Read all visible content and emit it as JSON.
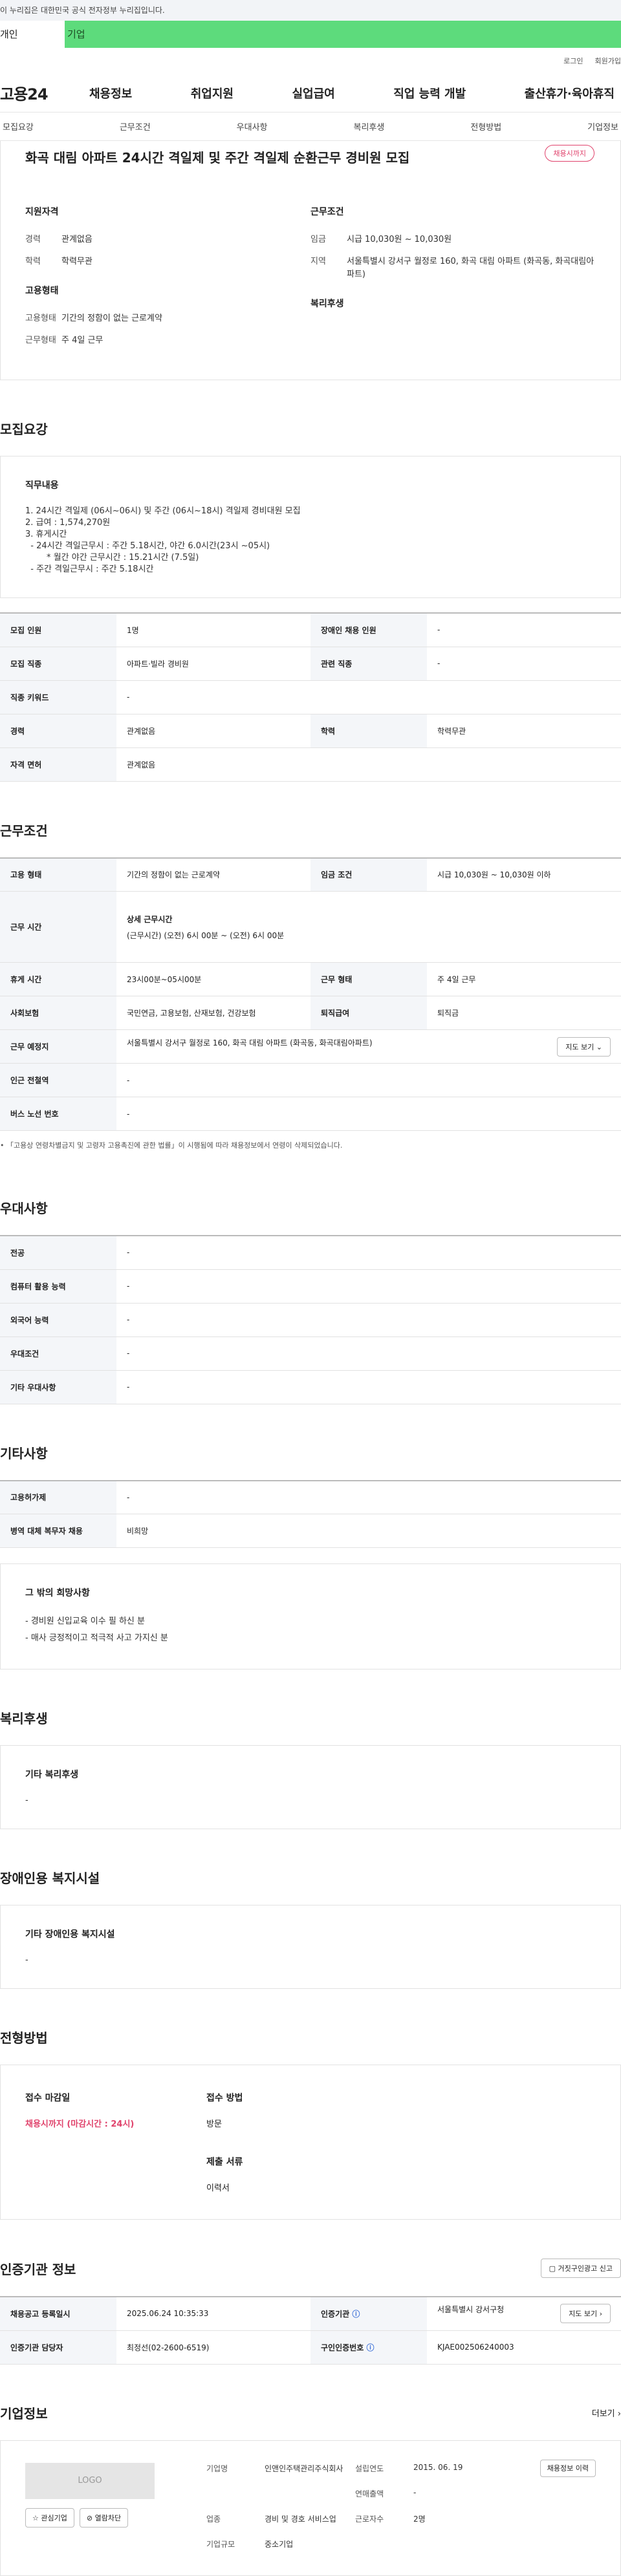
{
  "gov_bar": "이 누리집은 대한민국 공식 전자정부 누리집입니다.",
  "user_tabs": {
    "personal": "개인",
    "corp": "기업"
  },
  "util": {
    "login": "로그인",
    "join": "회원가입"
  },
  "logo": "고용24",
  "gnb": [
    "채용정보",
    "취업지원",
    "실업급여",
    "직업 능력 개발",
    "출산휴가·육아휴직"
  ],
  "subtabs": [
    "모집요강",
    "근무조건",
    "우대사항",
    "복리후생",
    "전형방법",
    "기업정보"
  ],
  "summary": {
    "title": "화곡 대림 아파트 24시간 격일제 및 주간 격일제 순환근무 경비원 모집",
    "badge": "채용시까지",
    "qual_title": "지원자격",
    "career_k": "경력",
    "career_v": "관계없음",
    "edu_k": "학력",
    "edu_v": "학력무관",
    "cond_title": "근무조건",
    "wage_k": "임금",
    "wage_v": "시급 10,030원 ~ 10,030원",
    "area_k": "지역",
    "area_v": "서울특별시 강서구 월정로 160, 화곡 대림 아파트 (화곡동, 화곡대림아파트)",
    "emp_title": "고용형태",
    "emp_k": "고용형태",
    "emp_v": "기간의 정함이 없는 근로계약",
    "form_k": "근무형태",
    "form_v": "주 4일 근무",
    "welfare_title": "복리후생"
  },
  "recruit": {
    "title": "모집요강",
    "job_title": "직무내용",
    "job_text": "1. 24시간 격일제 (06시~06시) 및 주간 (06시~18시) 격일제 경비대원 모집\n2. 급여 : 1,574,270원\n3. 휴게시간\n  - 24시간 격일근무시 : 주간 5.18시간, 야간 6.0시간(23시 ~05시)\n        * 월간 야간 근무시간 : 15.21시간 (7.5일)\n  - 주간 격일근무시 : 주간 5.18시간",
    "rows": [
      [
        "모집 인원",
        "1명",
        "장애인 채용 인원",
        "-"
      ],
      [
        "모집 직종",
        "아파트·빌라 경비원",
        "관련 직종",
        "-"
      ],
      [
        "직종 키워드",
        "-"
      ],
      [
        "경력",
        "관계없음",
        "학력",
        "학력무관"
      ],
      [
        "자격 면허",
        "관계없음"
      ]
    ]
  },
  "work": {
    "title": "근무조건",
    "type_k": "고용 형태",
    "type_v": "기간의 정함이 없는 근로계약",
    "wage_k": "임금 조건",
    "wage_v": "시급 10,030원 ~ 10,030원 이하",
    "time_k": "근무 시간",
    "time_sub": "상세 근무시간",
    "time_v": "(근무시간) (오전) 6시 00분 ~ (오전) 6시 00분",
    "rest_k": "휴게 시간",
    "rest_v": "23시00분~05시00분",
    "form_k": "근무 형태",
    "form_v": "주 4일 근무",
    "ins_k": "사회보험",
    "ins_v": "국민연금, 고용보험, 산재보험, 건강보험",
    "sev_k": "퇴직급여",
    "sev_v": "퇴직금",
    "place_k": "근무 예정지",
    "place_v": "서울특별시 강서구 월정로 160, 화곡 대림 아파트 (화곡동, 화곡대림아파트)",
    "map_btn": "지도 보기",
    "subway_k": "인근 전철역",
    "subway_v": "-",
    "bus_k": "버스 노선 번호",
    "bus_v": "-",
    "note": "「고용상 연령차별금지 및 고령자 고용촉진에 관한 법률」이 시행됨에 따라 채용정보에서 연령이 삭제되었습니다."
  },
  "pref": {
    "title": "우대사항",
    "rows": [
      [
        "전공",
        "-"
      ],
      [
        "컴퓨터 활용 능력",
        "-"
      ],
      [
        "외국어 능력",
        "-"
      ],
      [
        "우대조건",
        "-"
      ],
      [
        "기타 우대사항",
        "-"
      ]
    ]
  },
  "etc": {
    "title": "기타사항",
    "rows": [
      [
        "고용허가제",
        "-"
      ],
      [
        "병역 대체 복무자 채용",
        "비희망"
      ]
    ],
    "box_title": "그 밖의 희망사항",
    "box_text": "- 경비원 신입교육 이수 필 하신 분\n- 매사 긍정적이고 적극적 사고 가지신 분"
  },
  "welfare": {
    "title": "복리후생",
    "box_title": "기타 복리후생",
    "box_text": "-"
  },
  "disabled": {
    "title": "장애인용 복지시설",
    "box_title": "기타 장애인용 복지시설",
    "box_text": "-"
  },
  "process": {
    "title": "전형방법",
    "deadline_k": "접수 마감일",
    "deadline_v": "채용시까지 (마감시간 : 24시)",
    "method_k": "접수 방법",
    "method_v": "방문",
    "docs_k": "제출 서류",
    "docs_v": "이력서"
  },
  "agency": {
    "title": "인증기관 정보",
    "report_btn": "거짓구인광고 신고",
    "date_k": "채용공고 등록일시",
    "date_v": "2025.06.24 10:35:33",
    "org_k": "인증기관",
    "org_v": "서울특별시 강서구청",
    "map_btn": "지도 보기",
    "staff_k": "인증기관 담당자",
    "staff_v": "최정선(02-2600-6519)",
    "num_k": "구인인증번호",
    "num_v": "KJAE002506240003"
  },
  "corp": {
    "title": "기업정보",
    "more": "더보기",
    "logo": "LOGO",
    "fav_btn": "관심기업",
    "block_btn": "열람차단",
    "name_k": "기업명",
    "name_v": "인앤인주택관리주식회사",
    "year_k": "설립연도",
    "year_v": "2015. 06. 19",
    "sales_k": "연매출액",
    "sales_v": "-",
    "ind_k": "업종",
    "ind_v": "경비 및 경호 서비스업",
    "staff_k": "근로자수",
    "staff_v": "2명",
    "size_k": "기업규모",
    "size_v": "중소기업",
    "history_btn": "채용정보 이력"
  }
}
